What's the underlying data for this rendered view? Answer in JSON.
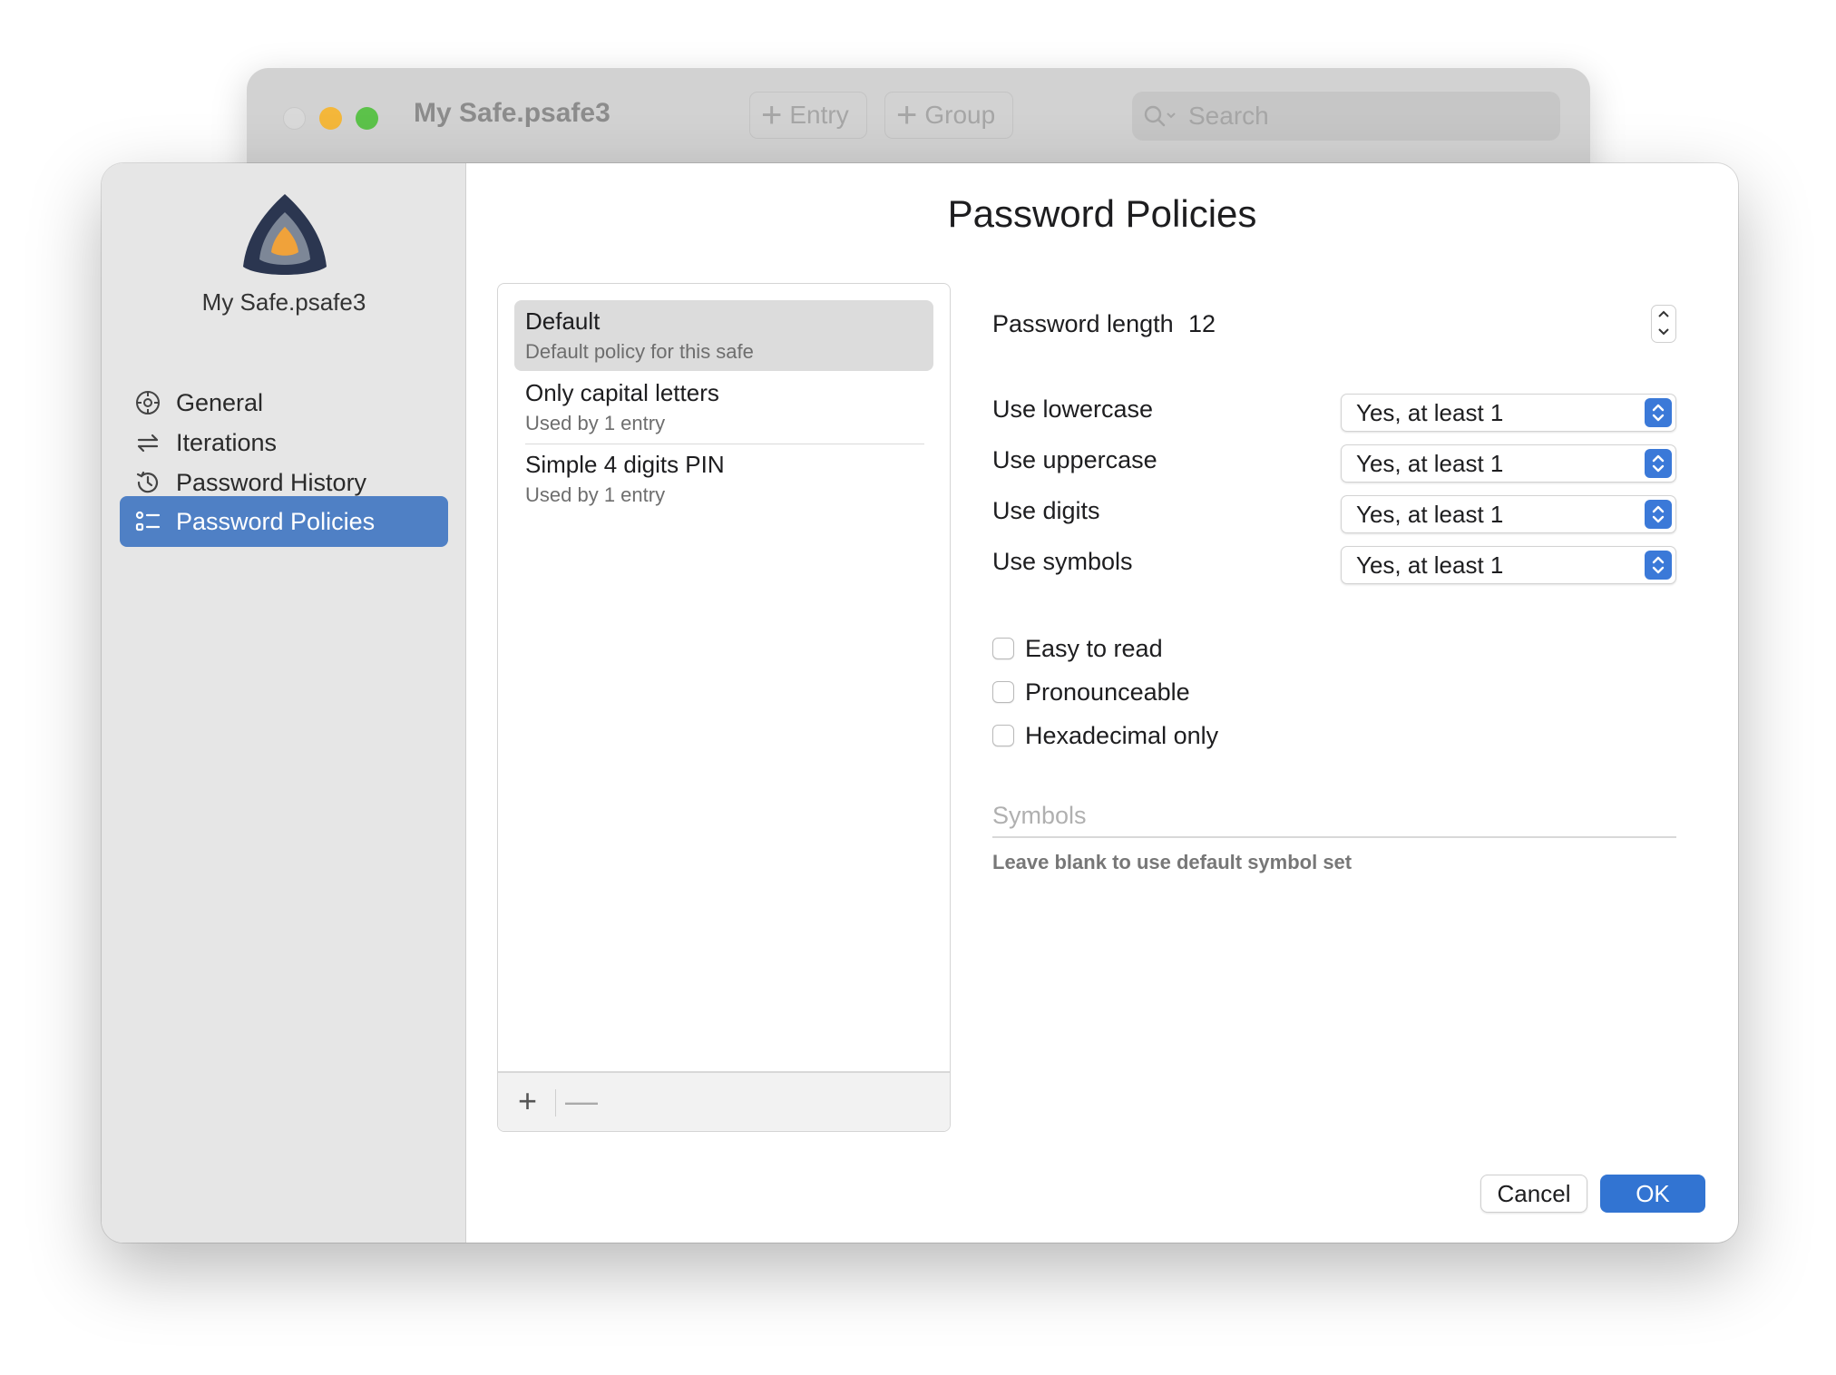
{
  "background_window": {
    "title": "My Safe.psafe3",
    "toolbar": {
      "entry_label": "Entry",
      "group_label": "Group"
    },
    "search": {
      "placeholder": "Search"
    }
  },
  "dialog": {
    "title": "Password Policies",
    "sidebar": {
      "safe_name": "My Safe.psafe3",
      "items": [
        {
          "label": "General",
          "icon": "gear-icon"
        },
        {
          "label": "Iterations",
          "icon": "arrows-exchange-icon"
        },
        {
          "label": "Password History",
          "icon": "history-icon"
        },
        {
          "label": "Password Policies",
          "icon": "checklist-icon",
          "selected": true
        }
      ]
    },
    "policies": [
      {
        "name": "Default",
        "subtitle": "Default policy for this safe",
        "selected": true
      },
      {
        "name": "Only capital letters",
        "subtitle": "Used by 1 entry"
      },
      {
        "name": "Simple 4 digits PIN",
        "subtitle": "Used by 1 entry"
      }
    ],
    "list_footer": {
      "add": "+",
      "remove": "—"
    },
    "settings": {
      "length_label": "Password length",
      "length_value": "12",
      "char_options": [
        {
          "label": "Use lowercase",
          "value": "Yes, at least 1"
        },
        {
          "label": "Use uppercase",
          "value": "Yes, at least 1"
        },
        {
          "label": "Use digits",
          "value": "Yes, at least 1"
        },
        {
          "label": "Use symbols",
          "value": "Yes, at least 1"
        }
      ],
      "checkboxes": [
        {
          "label": "Easy to read",
          "checked": false
        },
        {
          "label": "Pronounceable",
          "checked": false
        },
        {
          "label": "Hexadecimal only",
          "checked": false
        }
      ],
      "symbols_placeholder": "Symbols",
      "symbols_hint": "Leave blank to use default symbol set"
    },
    "buttons": {
      "cancel": "Cancel",
      "ok": "OK"
    }
  },
  "colors": {
    "accent": "#3274d2",
    "sidebar_selected": "#4f80c5",
    "logo_dark": "#2b3650",
    "logo_orange": "#f0a23a"
  }
}
